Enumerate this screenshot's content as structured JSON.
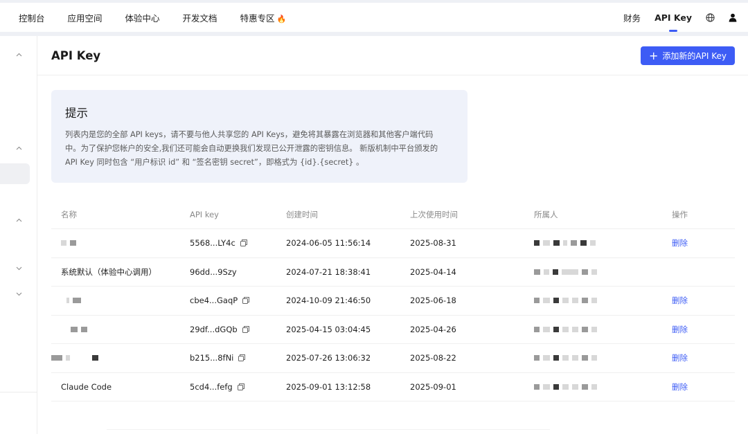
{
  "nav": {
    "items": [
      {
        "label": "控制台"
      },
      {
        "label": "应用空间"
      },
      {
        "label": "体验中心"
      },
      {
        "label": "开发文档"
      },
      {
        "label": "特惠专区"
      }
    ],
    "right": {
      "finance": "财务",
      "api_key": "API Key"
    },
    "icons": {
      "globe": "globe-icon",
      "user": "user-icon",
      "fire": "fire-icon"
    }
  },
  "page": {
    "title": "API Key",
    "add_button": "添加新的API Key"
  },
  "notice": {
    "title": "提示",
    "body_line1": "列表内是您的全部 API keys，请不要与他人共享您的 API Keys，避免将其暴露在浏览器和其他客户端代码",
    "body_line2": "中。为了保护您帐户的安全,我们还可能会自动更换我们发现已公开泄露的密钥信息。 新版机制中平台颁发的",
    "body_line3": "API Key 同时包含 “用户标识 id” 和 “签名密钥 secret”，即格式为 {id}.{secret} 。"
  },
  "table": {
    "headers": {
      "name": "名称",
      "api_key": "API key",
      "created": "创建时间",
      "last_used": "上次使用时间",
      "owner": "所属人",
      "actions": "操作"
    },
    "rows": [
      {
        "name": "",
        "key": "5568...LY4c",
        "copy": true,
        "created": "2024-06-05 11:56:14",
        "last_used": "2025-08-31",
        "action": "删除"
      },
      {
        "name": "系统默认（体验中心调用）",
        "key": "96dd...9Szy",
        "copy": false,
        "created": "2024-07-21 18:38:41",
        "last_used": "2025-04-14",
        "action": ""
      },
      {
        "name": "",
        "key": "cbe4...GaqP",
        "copy": true,
        "created": "2024-10-09 21:46:50",
        "last_used": "2025-06-18",
        "action": "删除"
      },
      {
        "name": "",
        "key": "29df...dGQb",
        "copy": true,
        "created": "2025-04-15 03:04:45",
        "last_used": "2025-04-26",
        "action": "删除"
      },
      {
        "name": "",
        "key": "b215...8fNi",
        "copy": true,
        "created": "2025-07-26 13:06:32",
        "last_used": "2025-08-22",
        "action": "删除"
      },
      {
        "name": "Claude Code",
        "key": "5cd4...fefg",
        "copy": true,
        "created": "2025-09-01 13:12:58",
        "last_used": "2025-09-01",
        "action": "删除"
      }
    ]
  },
  "colors": {
    "accent": "#3d5cf5",
    "fire": "#f5731a",
    "notice_bg": "#eff2fa"
  }
}
